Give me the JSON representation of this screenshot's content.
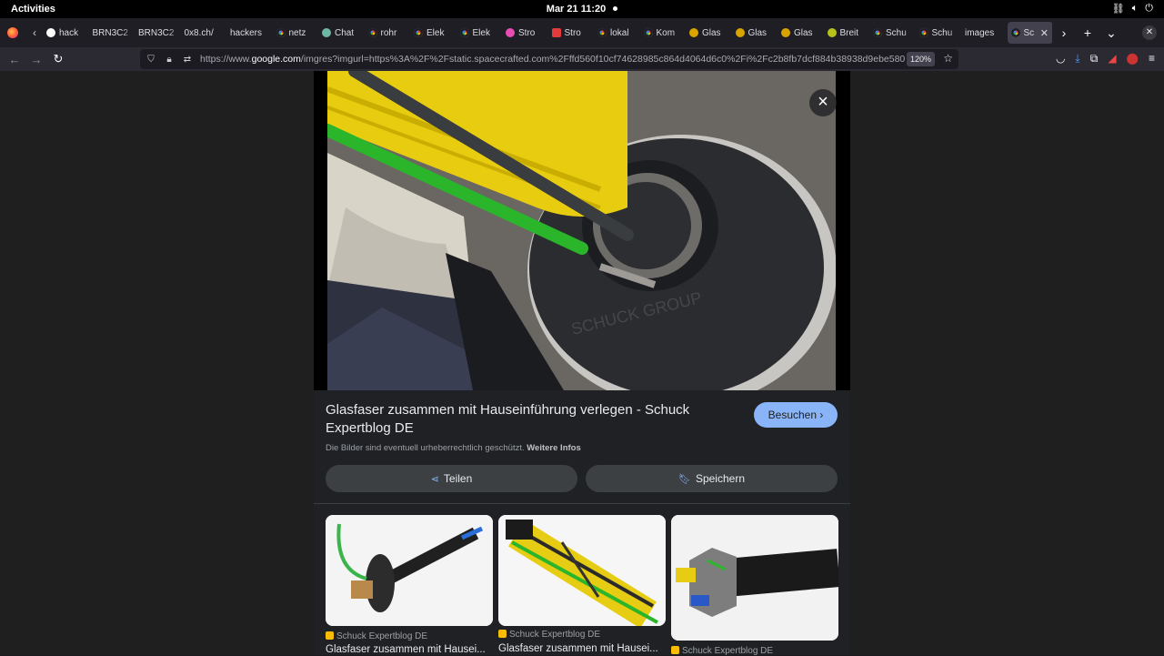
{
  "system": {
    "activities": "Activities",
    "clock": "Mar 21  11:20"
  },
  "browser": {
    "tabs": [
      {
        "label": "hack",
        "fav": "github"
      },
      {
        "label": "BRN3C2",
        "fav": "none"
      },
      {
        "label": "BRN3C2",
        "fav": "none"
      },
      {
        "label": "0x8.ch/",
        "fav": "none"
      },
      {
        "label": "hackers",
        "fav": "none"
      },
      {
        "label": "netz",
        "fav": "g"
      },
      {
        "label": "Chat",
        "fav": "chatgpt"
      },
      {
        "label": "rohr",
        "fav": "g"
      },
      {
        "label": "Elek",
        "fav": "g"
      },
      {
        "label": "Elek",
        "fav": "g"
      },
      {
        "label": "Stro",
        "fav": "multi"
      },
      {
        "label": "Stro",
        "fav": "red"
      },
      {
        "label": "lokal",
        "fav": "g"
      },
      {
        "label": "Kom",
        "fav": "g"
      },
      {
        "label": "Glas",
        "fav": "yellow"
      },
      {
        "label": "Glas",
        "fav": "yellow"
      },
      {
        "label": "Glas",
        "fav": "yellow"
      },
      {
        "label": "Breit",
        "fav": "lime"
      },
      {
        "label": "Schu",
        "fav": "g"
      },
      {
        "label": "Schu",
        "fav": "g"
      },
      {
        "label": "images",
        "fav": "none"
      },
      {
        "label": "Sc",
        "fav": "g",
        "active": true
      }
    ],
    "url_prefix": "https://www.",
    "url_domain": "google.com",
    "url_rest": "/imgres?imgurl=https%3A%2F%2Fstatic.spacecrafted.com%2Fffd560f10cf74628985c864d4064d6c0%2Fi%2Fc2b8fb7dcf884b38938d9ebe580",
    "zoom": "120%"
  },
  "viewer": {
    "title": "Glasfaser zusammen mit Hauseinführung verlegen - Schuck Expertblog DE",
    "visit_label": "Besuchen",
    "copyright_text": "Die Bilder sind eventuell urheberrechtlich geschützt.",
    "copyright_link": "Weitere Infos",
    "share_label": "Teilen",
    "save_label": "Speichern",
    "photo_watermark": "SCHUCK GROUP"
  },
  "related": [
    {
      "source": "Schuck Expertblog DE",
      "caption": "Glasfaser zusammen mit Hausei..."
    },
    {
      "source": "Schuck Expertblog DE",
      "caption": "Glasfaser zusammen mit Hausei..."
    },
    {
      "source": "Schuck Expertblog DE",
      "caption": ""
    }
  ]
}
